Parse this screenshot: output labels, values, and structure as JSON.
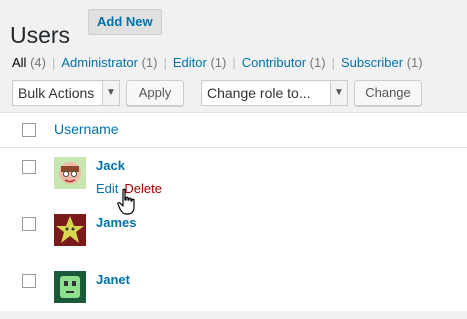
{
  "header": {
    "title": "Users",
    "add_new": "Add New"
  },
  "filters": {
    "all": {
      "label": "All",
      "count": "(4)"
    },
    "administrator": {
      "label": "Administrator",
      "count": "(1)"
    },
    "editor": {
      "label": "Editor",
      "count": "(1)"
    },
    "contributor": {
      "label": "Contributor",
      "count": "(1)"
    },
    "subscriber": {
      "label": "Subscriber",
      "count": "(1)"
    },
    "separator": "|"
  },
  "tablenav": {
    "bulk_actions": "Bulk Actions",
    "apply": "Apply",
    "change_role": "Change role to...",
    "change": "Change"
  },
  "table": {
    "column_username": "Username",
    "rows": [
      {
        "name": "Jack",
        "actions": {
          "edit": "Edit",
          "delete": "Delete"
        }
      },
      {
        "name": "James"
      },
      {
        "name": "Janet"
      }
    ]
  },
  "icons": {
    "cursor": "hand-pointer-icon",
    "select_arrow": "chevron-down-icon"
  },
  "colors": {
    "link": "#0073aa",
    "delete": "#aa0000",
    "background": "#f1f1f1"
  }
}
